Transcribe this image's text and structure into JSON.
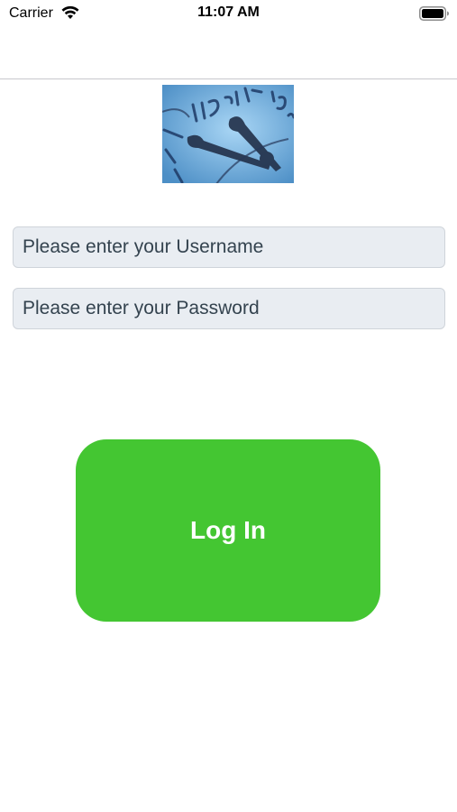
{
  "status_bar": {
    "carrier": "Carrier",
    "time": "11:07 AM",
    "wifi_icon": "wifi-icon",
    "battery_icon": "battery-icon"
  },
  "logo": {
    "icon": "clock-image"
  },
  "form": {
    "username_placeholder": "Please enter your Username",
    "username_value": "",
    "password_placeholder": "Please enter your Password",
    "password_value": ""
  },
  "login_button": {
    "label": "Log In",
    "color": "#44c632"
  }
}
